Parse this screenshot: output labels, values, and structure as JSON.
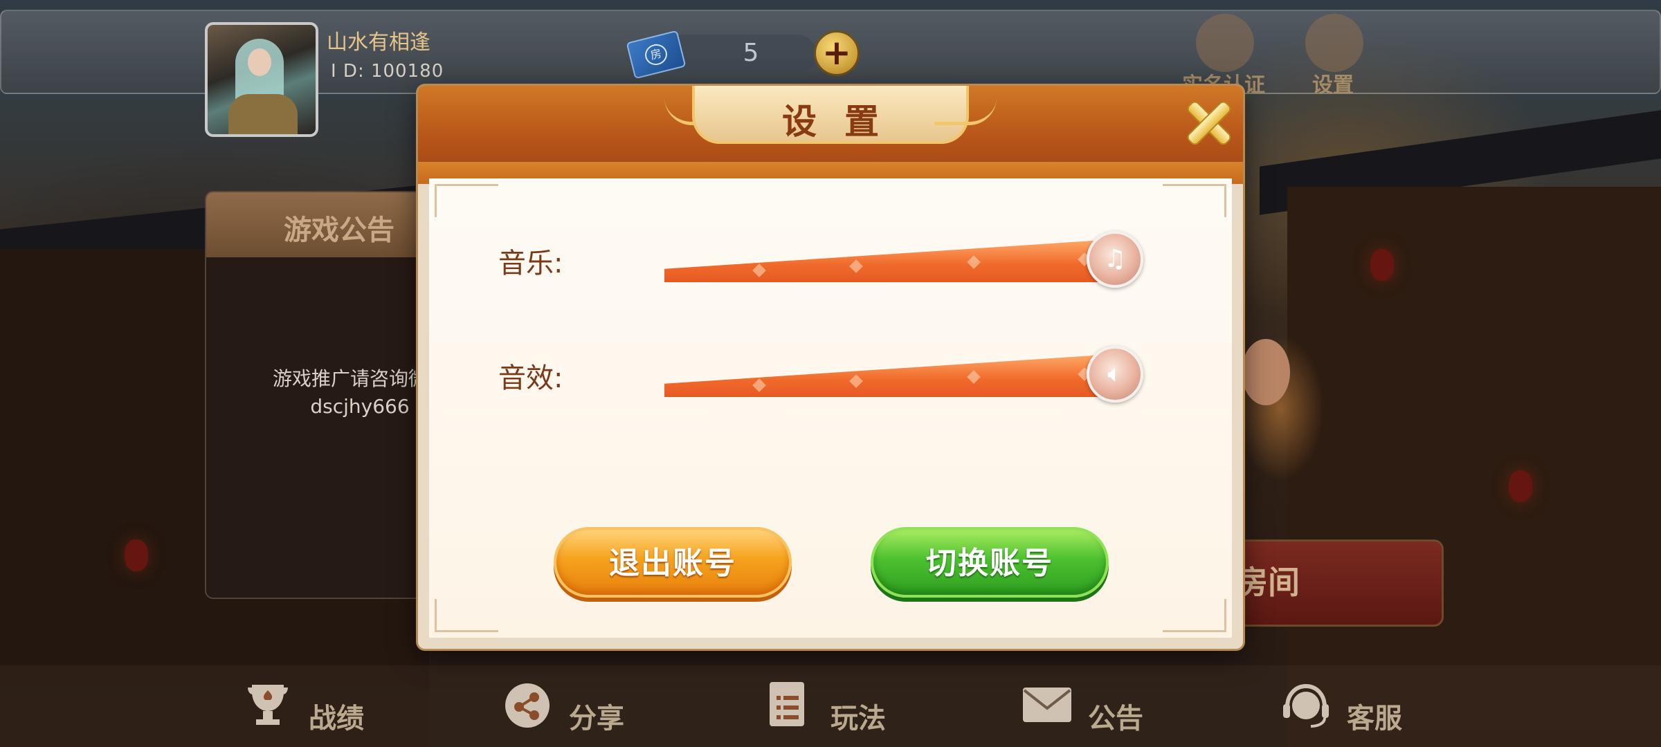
{
  "profile": {
    "nickname": "山水有相逢",
    "id_text": "I D: 100180"
  },
  "currency": {
    "count": "5"
  },
  "toolbar": {
    "real_name_label": "实名认证",
    "settings_label": "设置"
  },
  "notice": {
    "title": "游戏公告",
    "body_line1": "游戏推广请咨询微信",
    "body_line2": "dscjhy666"
  },
  "room": {
    "label": "房间"
  },
  "modal": {
    "title": "设置",
    "music_label": "音乐:",
    "sfx_label": "音效:",
    "music_level": 1.0,
    "sfx_level": 1.0,
    "logout_label": "退出账号",
    "switch_label": "切换账号"
  },
  "nav": {
    "items": [
      {
        "label": "战绩",
        "icon": "trophy-icon"
      },
      {
        "label": "分享",
        "icon": "share-icon"
      },
      {
        "label": "玩法",
        "icon": "rules-book-icon"
      },
      {
        "label": "公告",
        "icon": "mail-icon"
      },
      {
        "label": "客服",
        "icon": "headset-icon"
      }
    ]
  },
  "colors": {
    "modal_header": "#b8561a",
    "slider_fill": "#f06a2b",
    "logout_button": "#f5a21c",
    "switch_button": "#4cc12f"
  }
}
